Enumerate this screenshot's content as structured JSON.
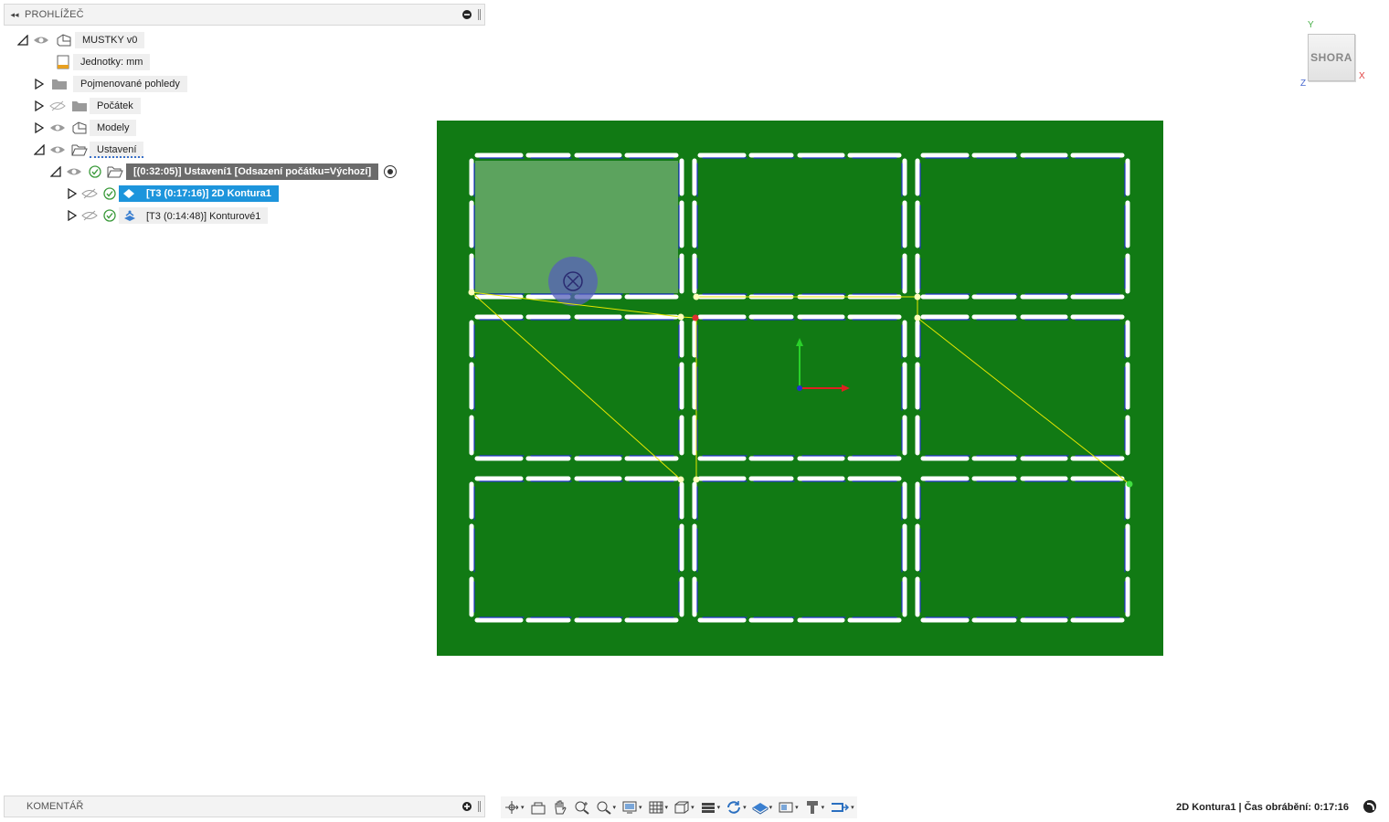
{
  "browser": {
    "title": "PROHLÍŽEČ",
    "tree": {
      "root": "MUSTKY v0",
      "units": "Jednotky: mm",
      "named_views": "Pojmenované pohledy",
      "origin": "Počátek",
      "models": "Modely",
      "setups": "Ustavení",
      "setup1": "[(0:32:05)] Ustavení1 [Odsazení počátku=Výchozí]",
      "op1": "[T3 (0:17:16)] 2D Kontura1",
      "op2": "[T3 (0:14:48)] Konturové1"
    }
  },
  "viewcube": {
    "face": "SHORA",
    "x": "X",
    "y": "Y",
    "z": "Z"
  },
  "comment": {
    "title": "KOMENTÁŘ"
  },
  "toolbar": {
    "buttons": [
      "orbit-icon",
      "look-at-icon",
      "pan-icon",
      "zoom-icon",
      "fit-icon",
      "display-settings-icon",
      "grid-icon",
      "view-options-icon",
      "layers-icon",
      "simulate-icon",
      "stock-icon",
      "effects-icon",
      "tool-icon",
      "toolpath-icon"
    ]
  },
  "status": {
    "text": "2D Kontura1 | Čas obrábění: 0:17:16"
  },
  "colors": {
    "stock": "#117a14",
    "selection": "#1d95dc",
    "toolpath_rapid": "#e6e600",
    "toolpath_cut": "#2233cc"
  }
}
